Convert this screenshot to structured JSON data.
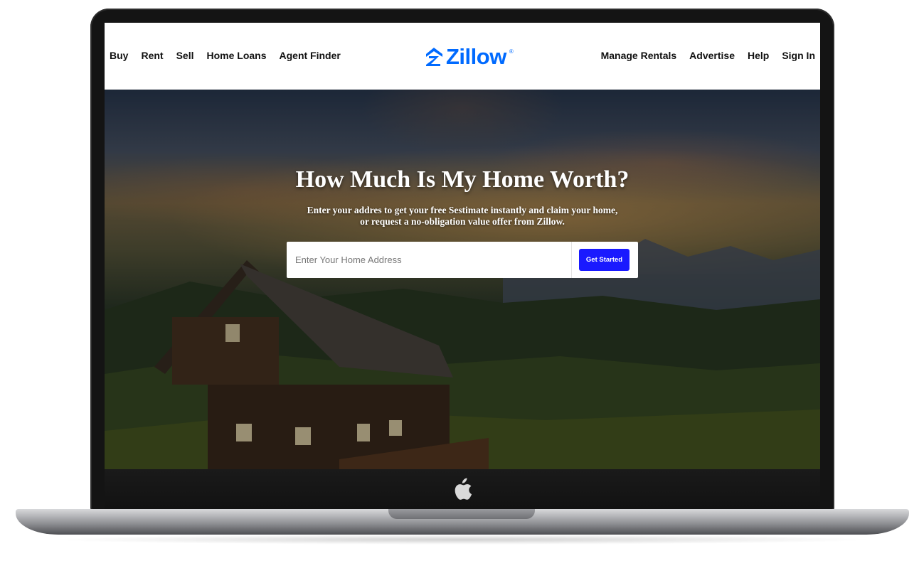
{
  "nav": {
    "left": [
      {
        "id": "buy",
        "label": "Buy"
      },
      {
        "id": "rent",
        "label": "Rent"
      },
      {
        "id": "sell",
        "label": "Sell"
      },
      {
        "id": "home-loans",
        "label": "Home Loans"
      },
      {
        "id": "agent-finder",
        "label": "Agent Finder"
      }
    ],
    "right": [
      {
        "id": "manage-rentals",
        "label": "Manage Rentals"
      },
      {
        "id": "advertise",
        "label": "Advertise"
      },
      {
        "id": "help",
        "label": "Help"
      },
      {
        "id": "sign-in",
        "label": "Sign In"
      }
    ]
  },
  "brand": {
    "name": "Zillow",
    "registered": "®",
    "color": "#006aff",
    "icon": "zillow-house-icon"
  },
  "hero": {
    "title": "How Much Is My Home Worth?",
    "subtitle_line1": "Enter your addres to get your free Sestimate instantly and claim your home,",
    "subtitle_line2": "or request a no-obligation value offer from Zillow.",
    "search": {
      "placeholder": "Enter Your Home Address",
      "value": "",
      "button_label": "Get Started",
      "button_color": "#1a1aff"
    }
  },
  "device": {
    "logo_icon": "apple-icon"
  }
}
